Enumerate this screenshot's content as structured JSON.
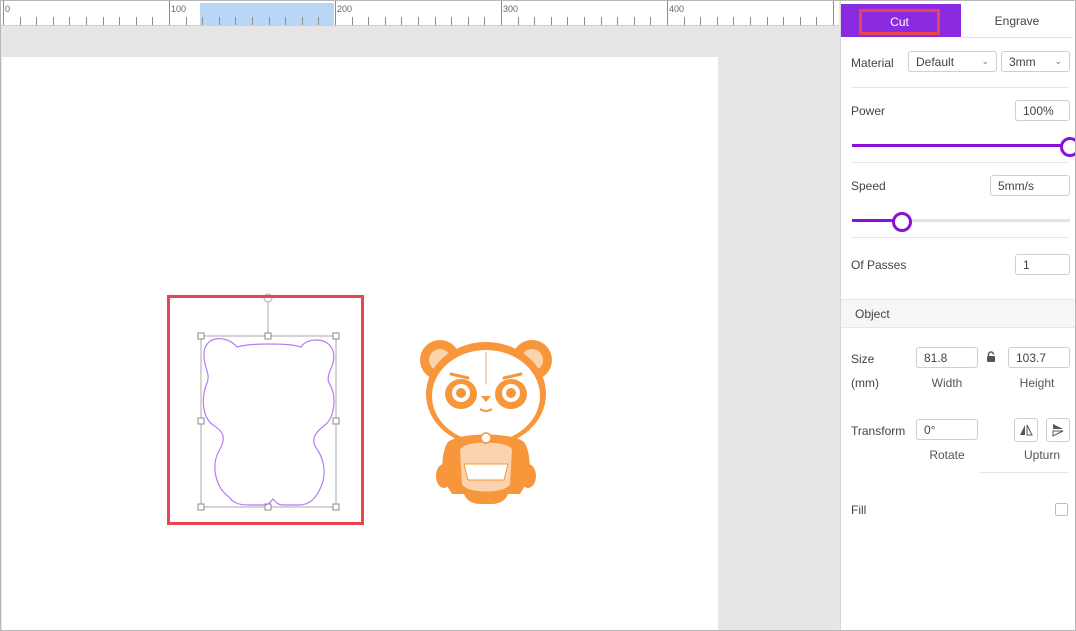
{
  "ruler": {
    "labels": [
      "0",
      "100",
      "200",
      "300",
      "400"
    ]
  },
  "tabs": {
    "cut": "Cut",
    "engrave": "Engrave"
  },
  "material": {
    "label": "Material",
    "material_value": "Default",
    "thickness_value": "3mm"
  },
  "power": {
    "label": "Power",
    "value": "100%",
    "level": 1.0
  },
  "speed": {
    "label": "Speed",
    "value": "5mm/s",
    "level": 0.23
  },
  "passes": {
    "label": "Of Passes",
    "value": "1"
  },
  "object": {
    "section_title": "Object",
    "size_label": "Size",
    "unit_label": "(mm)",
    "width_value": "81.8",
    "height_value": "103.7",
    "width_label": "Width",
    "height_label": "Height",
    "transform_label": "Transform",
    "rotate_value": "0°",
    "rotate_label": "Rotate",
    "upturn_label": "Upturn",
    "fill_label": "Fill"
  },
  "colors": {
    "accent": "#8a2be2",
    "highlight": "#e8464c",
    "panda": "#f7963b",
    "outline": "#b57bf0",
    "selection": "#b9d6f5"
  },
  "icons": [
    "lock-icon",
    "flip-horizontal-icon",
    "flip-vertical-icon",
    "rotate-handle-icon",
    "chevron-down-icon"
  ]
}
